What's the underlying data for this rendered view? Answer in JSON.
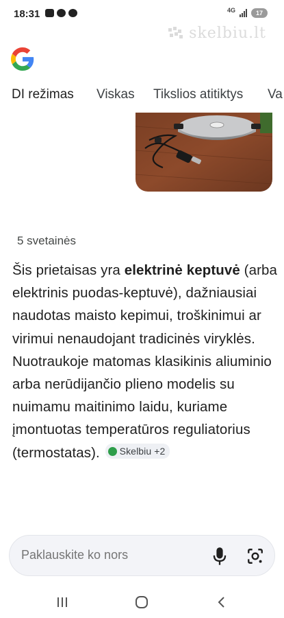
{
  "status_bar": {
    "time": "18:31",
    "network": "4G",
    "battery": "17",
    "icons": [
      "youtube-icon",
      "messenger-icon",
      "cloud-icon",
      "signal-icon"
    ]
  },
  "watermark": {
    "text": "skelbiu.lt"
  },
  "tabs": [
    {
      "label": "DI režimas",
      "active": true
    },
    {
      "label": "Viskas",
      "active": false
    },
    {
      "label": "Tikslios atitiktys",
      "active": false
    },
    {
      "label": "Va",
      "active": false
    }
  ],
  "sources": {
    "label": "5 svetainės"
  },
  "answer": {
    "part1": "Šis prietaisas yra ",
    "bold": "elektrinė keptuvė",
    "part2": " (arba elektrinis puodas-keptuvė), dažniausiai naudotas maisto kepimui, troškinimui ar virimui nenaudojant tradicinės viryklės. Nuotraukoje matomas klasikinis aliuminio arba nerūdijančio plieno modelis su nuimamu maitinimo laidu, kuriame įmontuotas temperatūros reguliatorius (termostatas).",
    "chip_label": "Skelbiu +2"
  },
  "search": {
    "placeholder": "Paklauskite ko nors"
  },
  "colors": {
    "accent": "#1a73e8",
    "chip_bg": "#eef0f4",
    "search_bg": "#f3f4f8"
  }
}
